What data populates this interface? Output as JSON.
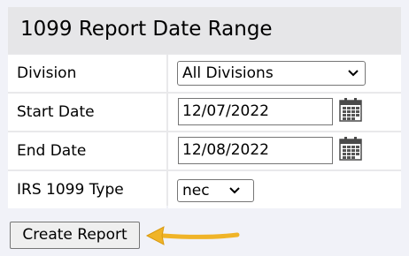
{
  "form": {
    "title": "1099 Report Date Range",
    "division": {
      "label": "Division",
      "value": "All Divisions"
    },
    "start_date": {
      "label": "Start Date",
      "value": "12/07/2022"
    },
    "end_date": {
      "label": "End Date",
      "value": "12/08/2022"
    },
    "irs_type": {
      "label": "IRS 1099 Type",
      "value": "nec"
    },
    "submit_label": "Create Report"
  },
  "icons": {
    "calendar": "calendar-icon",
    "chevron": "chevron-down-icon",
    "arrow": "arrow-left-icon"
  },
  "colors": {
    "page_bg": "#f1f2f8",
    "panel_bg": "#e9e9eb",
    "cell_bg": "#ffffff",
    "arrow": "#f0b428"
  }
}
